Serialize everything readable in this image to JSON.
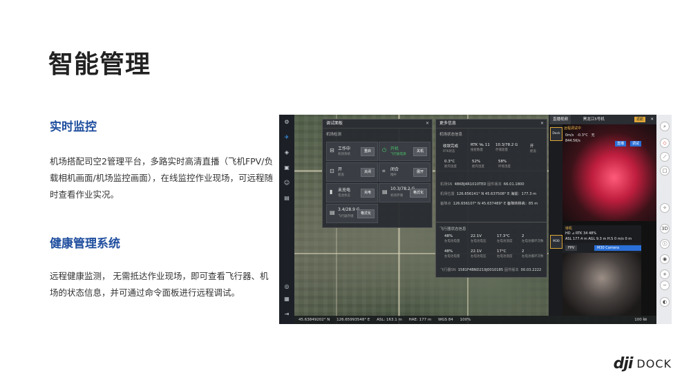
{
  "slide": {
    "title": "智能管理",
    "section1": {
      "heading": "实时监控",
      "body": "机场搭配司空2管理平台，多路实时高清直播（飞机FPV/负载相机画面/机场监控画面），在线监控作业现场，可远程随时查看作业实况。"
    },
    "section2": {
      "heading": "健康管理系统",
      "body": "远程健康监测， 无需抵达作业现场，即可查看飞行器、机场的状态信息，并可通过命令面板进行远程调试。"
    },
    "logo": {
      "mark": "dji",
      "word": "DOCK"
    }
  },
  "debug_panel": {
    "title": "调试面板",
    "section": "机场检测",
    "cards": [
      {
        "icon": "dock-icon",
        "label": "工作中",
        "sub": "机场系统",
        "button": "重启"
      },
      {
        "icon": "power-icon",
        "label": "开机",
        "sub": "飞行器电源",
        "button": "关机",
        "green": true
      },
      {
        "icon": "cover-icon",
        "label": "开",
        "sub": "舱盖",
        "button": "关闭"
      },
      {
        "icon": "pushrod-icon",
        "label": "闭合",
        "sub": "推杆",
        "button": "展开"
      },
      {
        "icon": "battery-icon",
        "label": "未充电",
        "sub": "电池状态",
        "button": "充电"
      },
      {
        "icon": "storage-icon",
        "label": "10.3/78.2 G",
        "sub": "机场存储",
        "button": "格式化"
      },
      {
        "icon": "storage-icon",
        "label": "3.4/28.9 G",
        "sub": "飞行器存储",
        "button": "格式化"
      }
    ]
  },
  "more_info": {
    "title": "更多信息",
    "dock_section": "机场状态信息",
    "top": [
      {
        "value": "收敛完成",
        "label": "RTK状态"
      },
      {
        "value": "RTK 🛰 11",
        "label": "搜星数量"
      },
      {
        "value": "10.3/78.2 G",
        "label": "存储容量"
      },
      {
        "value": "开",
        "label": "舱盖"
      }
    ],
    "mid": [
      {
        "value": "0.3°C",
        "label": "舱内温度"
      },
      {
        "value": "52%",
        "label": "舱内湿度"
      },
      {
        "value": "58%",
        "label": "环境湿度"
      }
    ],
    "rows": [
      {
        "label": "机场SN",
        "value": "4BKBJ4R1010TED",
        "label2": "固件版本",
        "value2": "66.01.1800"
      },
      {
        "label": "机场位置",
        "value": "126.656141° N  45.637508° E  海拔：177.3 m"
      },
      {
        "label": "备降点",
        "value": "126.656107° N  45.637489° E  备降转移高：85 m"
      }
    ],
    "aircraft_section": "飞行器状态信息",
    "a_row1": [
      {
        "value": "48%",
        "label": "左电池电量"
      },
      {
        "value": "22.1V",
        "label": "左电池电压"
      },
      {
        "value": "17.3°C",
        "label": "左电池温度"
      },
      {
        "value": "2",
        "label": "左电池循环次数"
      }
    ],
    "a_row2": [
      {
        "value": "48%",
        "label": "右电池电量"
      },
      {
        "value": "22.1V",
        "label": "右电池电压"
      },
      {
        "value": "17°C",
        "label": "右电池温度"
      },
      {
        "value": "2",
        "label": "右电池循环次数"
      }
    ],
    "sn_row": {
      "label": "飞行器SN",
      "value": "1581F4BND219J0010185",
      "label2": "固件版本",
      "value2": "00.03.2222"
    }
  },
  "video": {
    "tab": "直播视频",
    "title": "黑龙江5号机",
    "badge": "返航",
    "dock_tag": "Dock",
    "dock_label": "远程调试中",
    "dock_stats": [
      "0m/s",
      "-0.3°C",
      "无",
      "844.5K/s"
    ],
    "dock_btn1": "直播",
    "dock_btn2": "调试",
    "m30_tag": "M30",
    "m30_label": "待机",
    "m30_stats": "HD ⊿   RTK 34   48%",
    "m30_alt": "ASL 177.4 m   AGL 9.3 m   H.S 0 m/s   0 m",
    "cam_fpv": "FPV",
    "cam_m30": "M30 Camera"
  },
  "statusbar": {
    "lat": "45.63849202° N",
    "lon": "126.65993548° E",
    "asl": "ASL: 163.1 m",
    "hae": "HAE: 177 m",
    "wgs": "WGS 84",
    "zoom": "100%",
    "scale": "100 ㎞"
  }
}
